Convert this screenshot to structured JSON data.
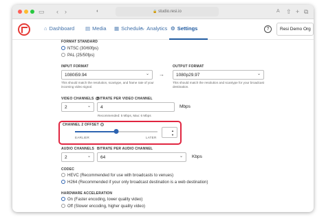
{
  "browser": {
    "url": "studio.resi.io",
    "icons": [
      "sidebar-icon",
      "back-icon",
      "forward-icon",
      "shield-icon",
      "translate-icon",
      "share-icon",
      "new-tab-icon",
      "tabs-icon"
    ]
  },
  "nav": {
    "items": [
      {
        "label": "Dashboard",
        "icon": "home-icon"
      },
      {
        "label": "Media",
        "icon": "media-icon"
      },
      {
        "label": "Schedule",
        "icon": "calendar-icon"
      },
      {
        "label": "Analytics",
        "icon": "chart-icon"
      },
      {
        "label": "Settings",
        "icon": "gear-icon"
      }
    ],
    "active": "Settings",
    "org": "Resi Demo Org",
    "help_glyph": "?"
  },
  "format_standard": {
    "label": "FORMAT STANDARD",
    "options": [
      "NTSC (30/60fps)",
      "PAL (25/50fps)"
    ],
    "selected": "NTSC (30/60fps)"
  },
  "input_format": {
    "label": "INPUT FORMAT",
    "value": "1080i59.94",
    "help": "This should match the resolution, scantype, and frame rate of your incoming video signal."
  },
  "output_format": {
    "label": "OUTPUT FORMAT",
    "value": "1080p29.97",
    "help": "This should match the resolution and scantype for your broadcast destination."
  },
  "video_channels": {
    "label": "VIDEO CHANNELS",
    "value": "2"
  },
  "bitrate_video": {
    "label": "BITRATE PER VIDEO CHANNEL",
    "value": "4",
    "unit": "Mbps",
    "hint": "Recommended: 5 Mbps, Max: 6 Mbps"
  },
  "channel_offset": {
    "label": "CHANNEL 2 OFFSET",
    "earlier": "EARLIER",
    "later": "LATER",
    "level": 0.5
  },
  "audio_channels": {
    "label": "AUDIO CHANNELS",
    "value": "2"
  },
  "bitrate_audio": {
    "label": "BITRATE PER AUDIO CHANNEL",
    "value": "64",
    "unit": "Kbps"
  },
  "codec": {
    "label": "CODEC",
    "options": [
      "HEVC (Recommended for use with broadcasts to venues)",
      "H264 (Recommended if your only broadcast destination is a web destination)"
    ],
    "selected": "H264 (Recommended if your only broadcast destination is a web destination)"
  },
  "hardware_acceleration": {
    "label": "HARDWARE ACCELERATION",
    "options": [
      "On (Faster encoding, lower quality video)",
      "Off (Slower encoding, higher quality video)"
    ],
    "selected": "On (Faster encoding, lower quality video)"
  },
  "colors": {
    "accent": "#2d63b0",
    "nav": "#1f5aa0",
    "highlight": "#e0243f",
    "logo": "#e53935"
  }
}
